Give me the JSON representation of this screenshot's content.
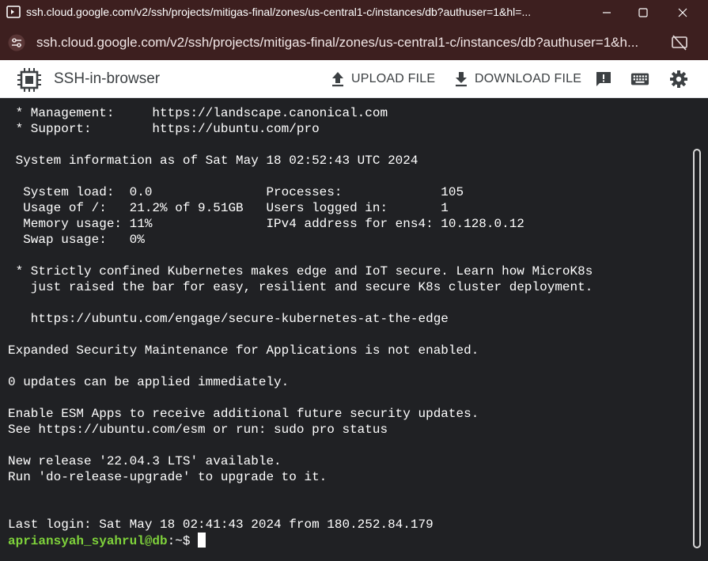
{
  "window": {
    "title": "ssh.cloud.google.com/v2/ssh/projects/mitigas-final/zones/us-central1-c/instances/db?authuser=1&hl=..."
  },
  "address": {
    "url": "ssh.cloud.google.com/v2/ssh/projects/mitigas-final/zones/us-central1-c/instances/db?authuser=1&h..."
  },
  "toolbar": {
    "brand": "SSH-in-browser",
    "upload_label": "UPLOAD FILE",
    "download_label": "DOWNLOAD FILE"
  },
  "terminal": {
    "lines": [
      " * Management:     https://landscape.canonical.com",
      " * Support:        https://ubuntu.com/pro",
      "",
      " System information as of Sat May 18 02:52:43 UTC 2024",
      "",
      "  System load:  0.0               Processes:             105",
      "  Usage of /:   21.2% of 9.51GB   Users logged in:       1",
      "  Memory usage: 11%               IPv4 address for ens4: 10.128.0.12",
      "  Swap usage:   0%",
      "",
      " * Strictly confined Kubernetes makes edge and IoT secure. Learn how MicroK8s",
      "   just raised the bar for easy, resilient and secure K8s cluster deployment.",
      "",
      "   https://ubuntu.com/engage/secure-kubernetes-at-the-edge",
      "",
      "Expanded Security Maintenance for Applications is not enabled.",
      "",
      "0 updates can be applied immediately.",
      "",
      "Enable ESM Apps to receive additional future security updates.",
      "See https://ubuntu.com/esm or run: sudo pro status",
      "",
      "New release '22.04.3 LTS' available.",
      "Run 'do-release-upgrade' to upgrade to it.",
      "",
      "",
      "Last login: Sat May 18 02:41:43 2024 from 180.252.84.179"
    ],
    "prompt_user": "apriansyah_syahrul@db",
    "prompt_path": ":~$ "
  },
  "colors": {
    "titlebar": "#3d1f1f",
    "terminal_bg": "#202124",
    "prompt_green": "#7fd33b"
  }
}
